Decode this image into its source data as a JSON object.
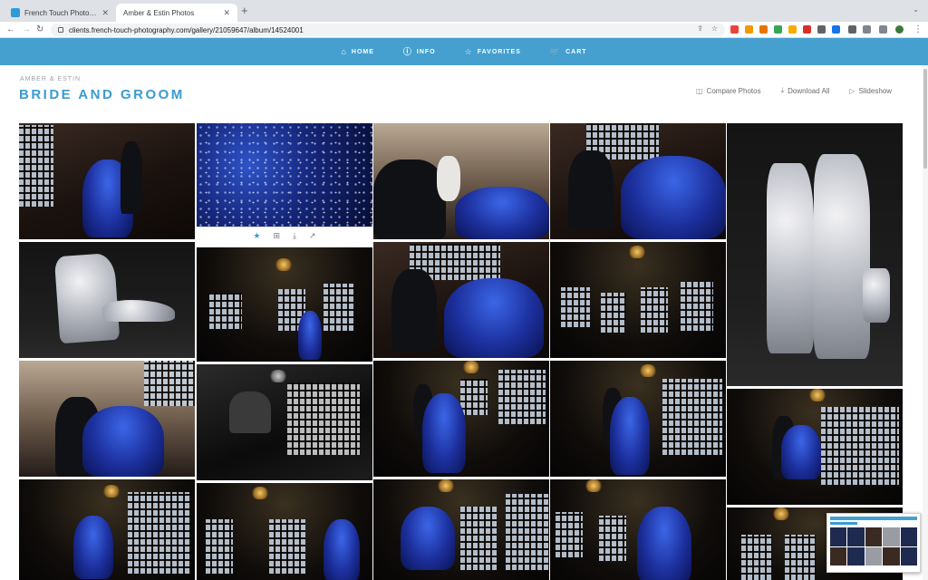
{
  "browser": {
    "tabs": [
      {
        "title": "French Touch Photography | Sh",
        "active": false
      },
      {
        "title": "Amber & Estin Photos",
        "active": true
      }
    ],
    "new_tab_icon": "+",
    "url": "clients.french-touch-photography.com/gallery/21059647/album/14524001"
  },
  "site_nav": [
    {
      "label": "HOME",
      "icon": "home-icon"
    },
    {
      "label": "INFO",
      "icon": "info-icon"
    },
    {
      "label": "FAVORITES",
      "icon": "star-icon"
    },
    {
      "label": "CART",
      "icon": "cart-icon"
    }
  ],
  "gallery": {
    "eyebrow": "AMBER & ESTIN",
    "title": "BRIDE AND GROOM",
    "actions": [
      {
        "label": "Compare Photos",
        "icon": "compare-icon"
      },
      {
        "label": "Download All",
        "icon": "download-icon"
      },
      {
        "label": "Slideshow",
        "icon": "play-icon"
      }
    ]
  },
  "photo_actions": [
    "star-icon",
    "cart-icon",
    "download-icon",
    "share-icon"
  ],
  "colors": {
    "accent": "#45a0d0",
    "title": "#3a9bd1"
  }
}
